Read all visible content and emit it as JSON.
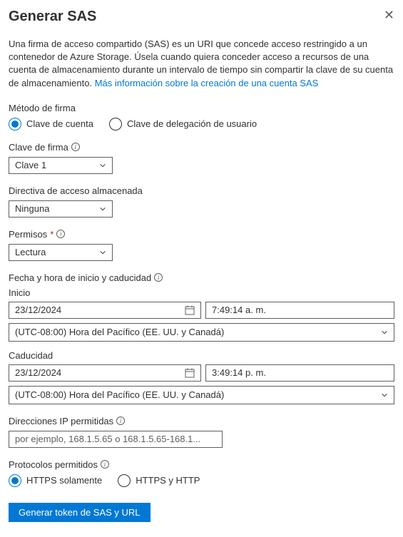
{
  "header": {
    "title": "Generar SAS"
  },
  "description": {
    "text": "Una firma de acceso compartido (SAS) es un URI que concede acceso restringido a un contenedor de Azure Storage. Úsela cuando quiera conceder acceso a recursos de una cuenta de almacenamiento durante un intervalo de tiempo sin compartir la clave de su cuenta de almacenamiento. ",
    "link": "Más información sobre la creación de una cuenta SAS"
  },
  "signingMethod": {
    "label": "Método de firma",
    "options": {
      "accountKey": "Clave de cuenta",
      "userDelegation": "Clave de delegación de usuario"
    },
    "selected": "accountKey"
  },
  "signingKey": {
    "label": "Clave de firma",
    "value": "Clave 1"
  },
  "storedPolicy": {
    "label": "Directiva de acceso almacenada",
    "value": "Ninguna"
  },
  "permissions": {
    "label": "Permisos",
    "value": "Lectura"
  },
  "dateTimeHeader": "Fecha y hora de inicio y caducidad",
  "start": {
    "label": "Inicio",
    "date": "23/12/2024",
    "time": "7:49:14 a. m.",
    "tz": "(UTC-08:00) Hora del Pacífico (EE. UU. y Canadá)"
  },
  "expiry": {
    "label": "Caducidad",
    "date": "23/12/2024",
    "time": "3:49:14 p. m.",
    "tz": "(UTC-08:00) Hora del Pacífico (EE. UU. y Canadá)"
  },
  "allowedIp": {
    "label": "Direcciones IP permitidas",
    "placeholder": "por ejemplo, 168.1.5.65 o 168.1.5.65-168.1..."
  },
  "protocols": {
    "label": "Protocolos permitidos",
    "options": {
      "httpsOnly": "HTTPS solamente",
      "httpsHttp": "HTTPS y HTTP"
    },
    "selected": "httpsOnly"
  },
  "generateButton": "Generar token de SAS y URL"
}
